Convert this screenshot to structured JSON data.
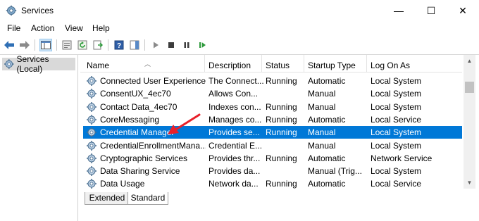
{
  "window": {
    "title": "Services"
  },
  "titlebar_controls": {
    "minimize": "—",
    "maximize": "☐",
    "close": "✕"
  },
  "menu": [
    "File",
    "Action",
    "View",
    "Help"
  ],
  "tree": {
    "item": "Services (Local)"
  },
  "columns": [
    "Name",
    "Description",
    "Status",
    "Startup Type",
    "Log On As"
  ],
  "rows": [
    {
      "name": "Connected User Experience...",
      "description": "The Connect...",
      "status": "Running",
      "startup": "Automatic",
      "logon": "Local System"
    },
    {
      "name": "ConsentUX_4ec70",
      "description": "Allows Con...",
      "status": "",
      "startup": "Manual",
      "logon": "Local System"
    },
    {
      "name": "Contact Data_4ec70",
      "description": "Indexes con...",
      "status": "Running",
      "startup": "Manual",
      "logon": "Local System"
    },
    {
      "name": "CoreMessaging",
      "description": "Manages co...",
      "status": "Running",
      "startup": "Automatic",
      "logon": "Local Service"
    },
    {
      "name": "Credential Manager",
      "description": "Provides se...",
      "status": "Running",
      "startup": "Manual",
      "logon": "Local System",
      "selected": true
    },
    {
      "name": "CredentialEnrollmentMana...",
      "description": "Credential E...",
      "status": "",
      "startup": "Manual",
      "logon": "Local System"
    },
    {
      "name": "Cryptographic Services",
      "description": "Provides thr...",
      "status": "Running",
      "startup": "Automatic",
      "logon": "Network Service"
    },
    {
      "name": "Data Sharing Service",
      "description": "Provides da...",
      "status": "",
      "startup": "Manual (Trig...",
      "logon": "Local System"
    },
    {
      "name": "Data Usage",
      "description": "Network da...",
      "status": "Running",
      "startup": "Automatic",
      "logon": "Local Service"
    }
  ],
  "tabs": [
    "Extended",
    "Standard"
  ],
  "colors": {
    "selection": "#0078d7",
    "annotation_arrow": "#e8202a"
  }
}
